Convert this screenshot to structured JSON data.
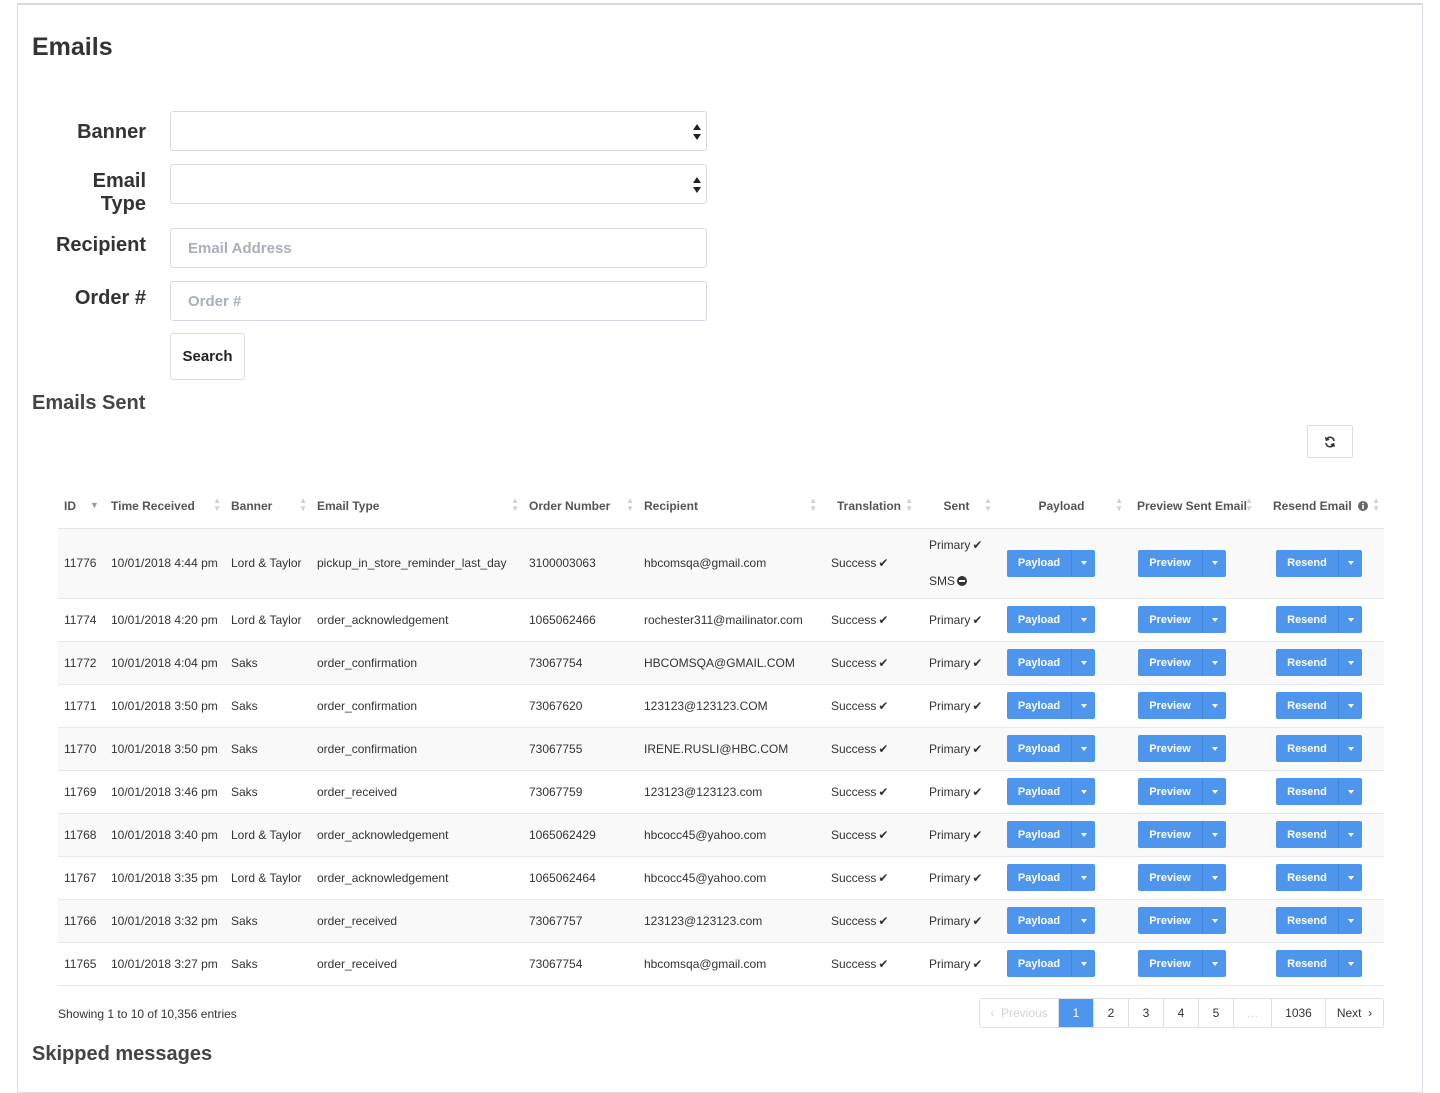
{
  "page": {
    "title": "Emails"
  },
  "form": {
    "banner_label": "Banner",
    "email_type_label_1": "Email",
    "email_type_label_2": "Type",
    "recipient_label": "Recipient",
    "recipient_placeholder": "Email Address",
    "order_label": "Order #",
    "order_placeholder": "Order #",
    "search_label": "Search"
  },
  "emails_sent": {
    "title": "Emails Sent",
    "columns": [
      "ID",
      "Time Received",
      "Banner",
      "Email Type",
      "Order Number",
      "Recipient",
      "Translation",
      "Sent",
      "Payload",
      "Preview Sent Email",
      "Resend Email"
    ],
    "button_labels": {
      "payload": "Payload",
      "preview": "Preview",
      "resend": "Resend"
    },
    "rows": [
      {
        "id": "11776",
        "time": "10/01/2018 4:44 pm",
        "banner": "Lord & Taylor",
        "email_type": "pickup_in_store_reminder_last_day",
        "order": "3100003063",
        "recipient": "hbcomsqa@gmail.com",
        "translation": "Success",
        "sent": "Primary",
        "sent2": "SMS"
      },
      {
        "id": "11774",
        "time": "10/01/2018 4:20 pm",
        "banner": "Lord & Taylor",
        "email_type": "order_acknowledgement",
        "order": "1065062466",
        "recipient": "rochester311@mailinator.com",
        "translation": "Success",
        "sent": "Primary"
      },
      {
        "id": "11772",
        "time": "10/01/2018 4:04 pm",
        "banner": "Saks",
        "email_type": "order_confirmation",
        "order": "73067754",
        "recipient": "HBCOMSQA@GMAIL.COM",
        "translation": "Success",
        "sent": "Primary"
      },
      {
        "id": "11771",
        "time": "10/01/2018 3:50 pm",
        "banner": "Saks",
        "email_type": "order_confirmation",
        "order": "73067620",
        "recipient": "123123@123123.COM",
        "translation": "Success",
        "sent": "Primary"
      },
      {
        "id": "11770",
        "time": "10/01/2018 3:50 pm",
        "banner": "Saks",
        "email_type": "order_confirmation",
        "order": "73067755",
        "recipient": "IRENE.RUSLI@HBC.COM",
        "translation": "Success",
        "sent": "Primary"
      },
      {
        "id": "11769",
        "time": "10/01/2018 3:46 pm",
        "banner": "Saks",
        "email_type": "order_received",
        "order": "73067759",
        "recipient": "123123@123123.com",
        "translation": "Success",
        "sent": "Primary"
      },
      {
        "id": "11768",
        "time": "10/01/2018 3:40 pm",
        "banner": "Lord & Taylor",
        "email_type": "order_acknowledgement",
        "order": "1065062429",
        "recipient": "hbcocc45@yahoo.com",
        "translation": "Success",
        "sent": "Primary"
      },
      {
        "id": "11767",
        "time": "10/01/2018 3:35 pm",
        "banner": "Lord & Taylor",
        "email_type": "order_acknowledgement",
        "order": "1065062464",
        "recipient": "hbcocc45@yahoo.com",
        "translation": "Success",
        "sent": "Primary"
      },
      {
        "id": "11766",
        "time": "10/01/2018 3:32 pm",
        "banner": "Saks",
        "email_type": "order_received",
        "order": "73067757",
        "recipient": "123123@123123.com",
        "translation": "Success",
        "sent": "Primary"
      },
      {
        "id": "11765",
        "time": "10/01/2018 3:27 pm",
        "banner": "Saks",
        "email_type": "order_received",
        "order": "73067754",
        "recipient": "hbcomsqa@gmail.com",
        "translation": "Success",
        "sent": "Primary"
      }
    ],
    "footer_info": "Showing 1 to 10 of 10,356 entries",
    "pagination": {
      "previous": "Previous",
      "pages": [
        "1",
        "2",
        "3",
        "4",
        "5"
      ],
      "ellipsis": "…",
      "last": "1036",
      "next": "Next",
      "active": "1"
    }
  },
  "skipped": {
    "title": "Skipped messages"
  },
  "colors": {
    "primary_button": "#4e96ed",
    "border": "#d6dae0"
  }
}
